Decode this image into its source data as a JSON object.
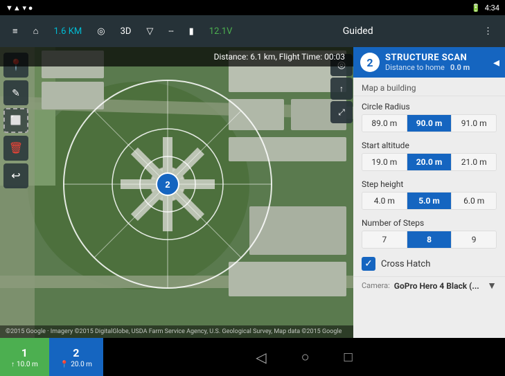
{
  "statusBar": {
    "time": "4:34",
    "battery": "12.1V",
    "signal": "▼▲",
    "wifi": "▾"
  },
  "toolbar": {
    "menuIcon": "≡",
    "homeIcon": "⌂",
    "distance": "1.6 KM",
    "locationIcon": "◎",
    "mode3d": "3D",
    "signal": "▽",
    "separator": "--",
    "batteryIcon": "▮",
    "voltage": "12.1V",
    "title": "Guided",
    "moreIcon": "⋮"
  },
  "flightInfo": {
    "label": "Distance: 6.1 km, Flight Time: 00:03"
  },
  "panel": {
    "stepNum": "2",
    "title": "STRUCTURE SCAN",
    "distanceLabel": "Distance to home",
    "distanceValue": "0.0 m",
    "subtitle": "Map a building",
    "circleRadius": {
      "label": "Circle Radius",
      "values": [
        "89.0 m",
        "90.0 m",
        "91.0 m"
      ],
      "selectedIndex": 1
    },
    "startAltitude": {
      "label": "Start altitude",
      "values": [
        "19.0 m",
        "20.0 m",
        "21.0 m"
      ],
      "selectedIndex": 1
    },
    "stepHeight": {
      "label": "Step height",
      "values": [
        "4.0 m",
        "5.0 m",
        "6.0 m"
      ],
      "selectedIndex": 1
    },
    "numSteps": {
      "label": "Number of Steps",
      "values": [
        "7",
        "8",
        "9"
      ],
      "selectedIndex": 1
    },
    "crossHatch": {
      "label": "Cross Hatch",
      "checked": true
    },
    "camera": {
      "label": "Camera:",
      "value": "GoPro Hero 4 Black (..."
    },
    "arrowIcon": "◂"
  },
  "mapControls": {
    "locationBtn": "◎",
    "upBtn": "↑",
    "collapseBtn": "⤢"
  },
  "leftTools": [
    {
      "icon": "📍",
      "name": "waypoint-tool"
    },
    {
      "icon": "✎",
      "name": "edit-tool"
    },
    {
      "icon": "⬜",
      "name": "region-tool"
    },
    {
      "icon": "🗑",
      "name": "delete-tool"
    },
    {
      "icon": "↩",
      "name": "undo-tool"
    }
  ],
  "waypointMarker": {
    "num": "2"
  },
  "bottomTabs": [
    {
      "num": "1",
      "icon": "↑",
      "value": "10.0 m",
      "color": "green"
    },
    {
      "num": "2",
      "icon": "📍",
      "value": "20.0 m",
      "color": "blue"
    }
  ],
  "bottomNav": {
    "back": "◁",
    "home": "○",
    "square": "□"
  },
  "mapCopyright": "©2015 Google · Imagery ©2015 DigitalGlobe, USDA Farm Service Agency, U.S. Geological Survey, Map data ©2015 Google"
}
